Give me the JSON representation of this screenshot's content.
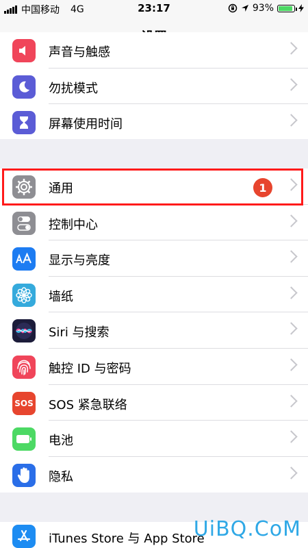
{
  "status": {
    "carrier": "中国移动",
    "network": "4G",
    "time": "23:17",
    "battery": "93%",
    "battery_level": 0.93
  },
  "nav": {
    "title": "设置"
  },
  "group1": [
    {
      "label": "声音与触感",
      "icon": "sound-icon",
      "color": "#f0455a"
    },
    {
      "label": "勿扰模式",
      "icon": "moon-icon",
      "color": "#5b5cd6"
    },
    {
      "label": "屏幕使用时间",
      "icon": "hourglass-icon",
      "color": "#5b5cd6"
    }
  ],
  "group2": [
    {
      "label": "通用",
      "icon": "gear-icon",
      "color": "#8e8e93",
      "badge": "1"
    },
    {
      "label": "控制中心",
      "icon": "toggle-icon",
      "color": "#8e8e93"
    },
    {
      "label": "显示与亮度",
      "icon": "text-size-icon",
      "color": "#1d7cf2"
    },
    {
      "label": "墙纸",
      "icon": "flower-icon",
      "color": "#35aadc"
    },
    {
      "label": "Siri 与搜索",
      "icon": "siri-icon",
      "color": "#1c1c3a"
    },
    {
      "label": "触控 ID 与密码",
      "icon": "fingerprint-icon",
      "color": "#f0455a"
    },
    {
      "label": "SOS 紧急联络",
      "icon": "sos-icon",
      "color": "#e7452e",
      "icon_text": "SOS"
    },
    {
      "label": "电池",
      "icon": "battery-icon",
      "color": "#4cd964"
    },
    {
      "label": "隐私",
      "icon": "hand-icon",
      "color": "#2a6ee8"
    }
  ],
  "group3": [
    {
      "label": "iTunes Store 与 App Store",
      "icon": "app-store-icon",
      "color": "#1d8cf2"
    }
  ],
  "watermark": "UiBQ.CoM"
}
